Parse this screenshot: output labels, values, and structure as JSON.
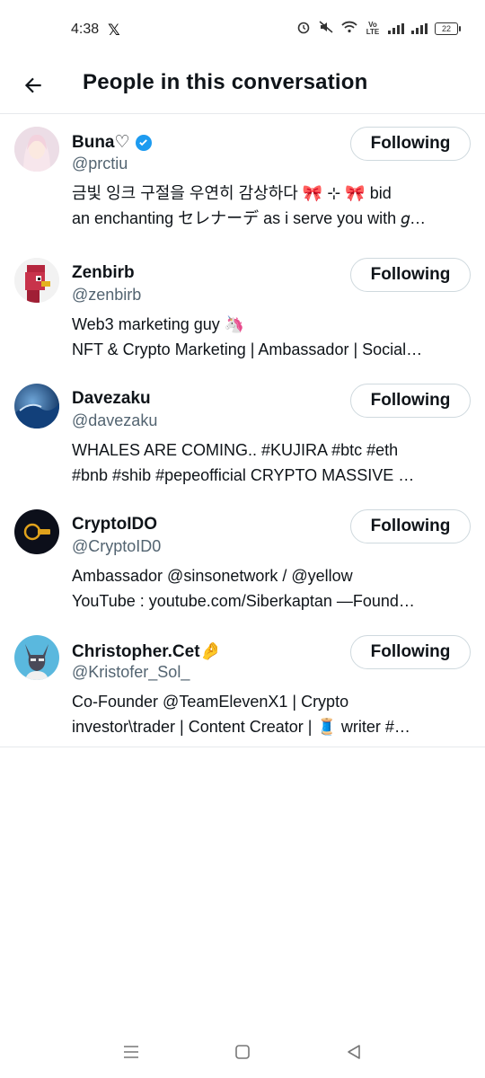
{
  "status_bar": {
    "time": "4:38",
    "app_icon": "x-logo",
    "icons": [
      "alarm-icon",
      "mute-icon",
      "wifi-icon",
      "volte-icon",
      "signal-icon",
      "signal-icon",
      "battery-icon"
    ],
    "vo_lte": "Vo LTE",
    "battery_level": "22"
  },
  "header": {
    "title": "People in this conversation",
    "back_icon": "arrow-left-icon"
  },
  "users": [
    {
      "name": "Buna♡",
      "handle": "@prctiu",
      "verified": true,
      "button": "Following",
      "bio_line1": "금빛 잉크 구절을 우연히 감상하다 🎀 ⊹ 🎀 bid",
      "bio_line2": "an enchanting セレナーデ as i serve you with 𝑔…"
    },
    {
      "name": "Zenbirb",
      "handle": "@zenbirb",
      "verified": false,
      "button": "Following",
      "bio_line1": "Web3 marketing guy 🦄",
      "bio_line2": "NFT & Crypto Marketing | Ambassador | Social…"
    },
    {
      "name": "Davezaku",
      "handle": "@davezaku",
      "verified": false,
      "button": "Following",
      "bio_line1": "WHALES ARE COMING.. #KUJIRA  #btc #eth",
      "bio_line2": "#bnb #shib #pepeofficial CRYPTO MASSIVE …"
    },
    {
      "name": "CryptoIDO",
      "handle": "@CryptoID0",
      "verified": false,
      "button": "Following",
      "bio_line1": "Ambassador @sinsonetwork / @yellow",
      "bio_line2": "YouTube : youtube.com/Siberkaptan —Found…"
    },
    {
      "name": "Christopher.Cet🤌",
      "handle": "@Kristofer_Sol_",
      "verified": false,
      "button": "Following",
      "bio_line1": "Co-Founder @TeamElevenX1 | Crypto",
      "bio_line2": "investor\\trader | Content Creator | 🧵 writer #…"
    }
  ],
  "nav_bar": {
    "icons": [
      "recents-icon",
      "home-icon",
      "back-icon"
    ]
  },
  "colors": {
    "text": "#0f1419",
    "secondary": "#536471",
    "border": "#cfd9de",
    "verified": "#1d9bf0"
  }
}
